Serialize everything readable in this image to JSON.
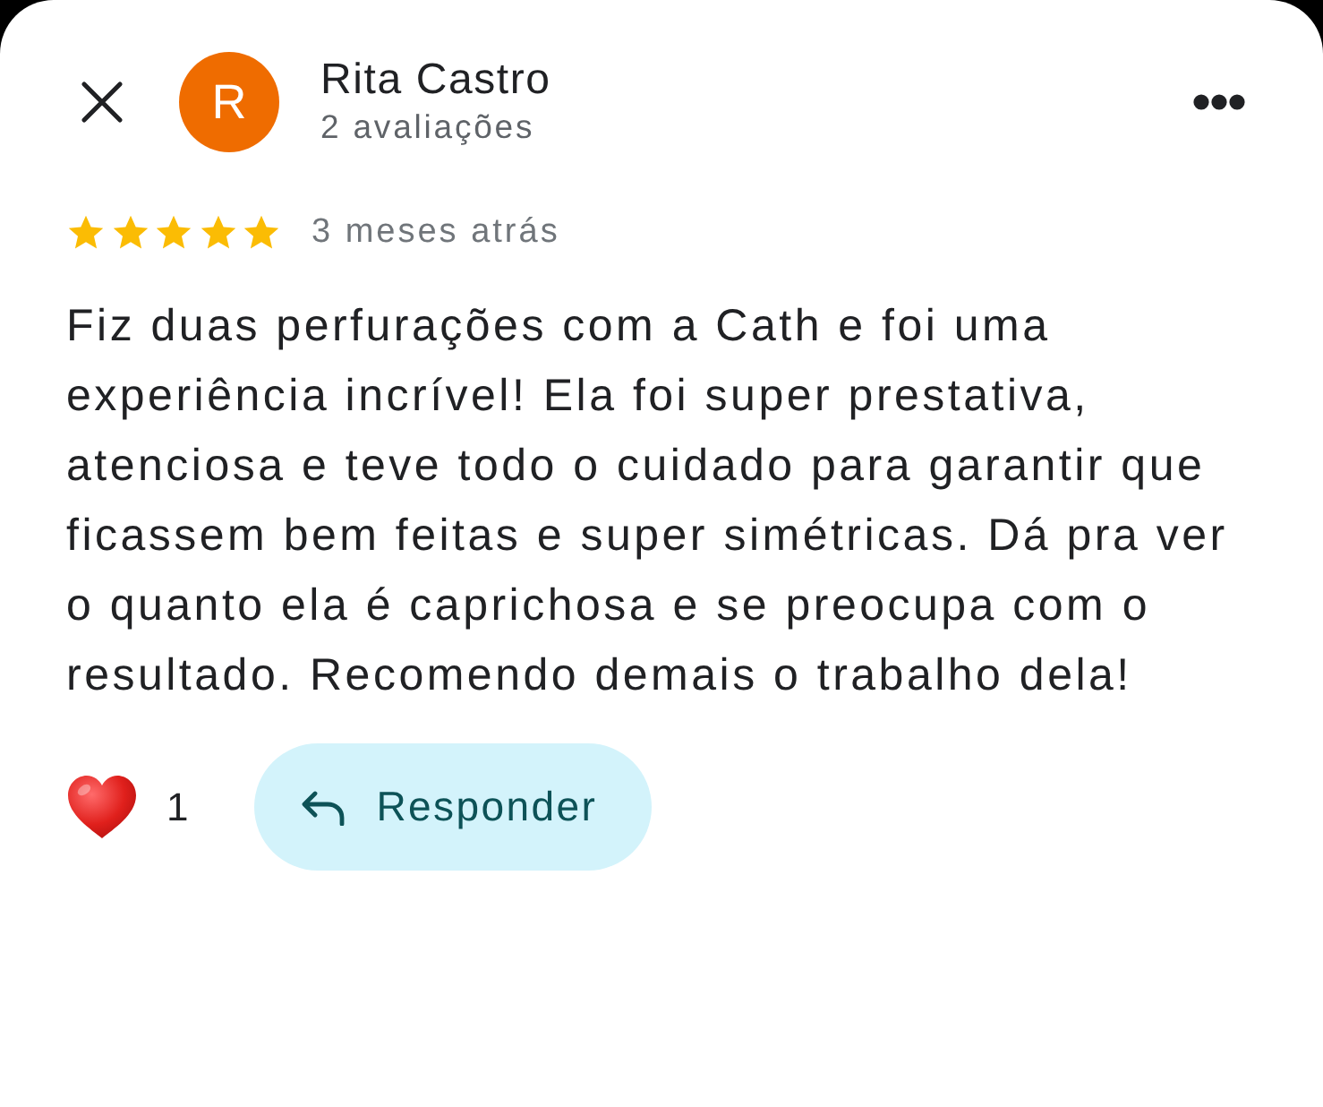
{
  "reviewer": {
    "initial": "R",
    "name": "Rita Castro",
    "reviews": "2 avaliações"
  },
  "review": {
    "stars": 5,
    "time": "3 meses atrás",
    "text": "Fiz duas perfurações com a Cath e foi uma experiência incrível! Ela foi super prestativa, atenciosa e teve todo o cuidado para garantir que ficassem bem feitas e super simétricas. Dá pra ver o quanto ela é caprichosa e se preocupa com o resultado. Recomendo demais o trabalho dela!"
  },
  "reactions": {
    "count": "1"
  },
  "reply_button": {
    "label": "Responder"
  }
}
